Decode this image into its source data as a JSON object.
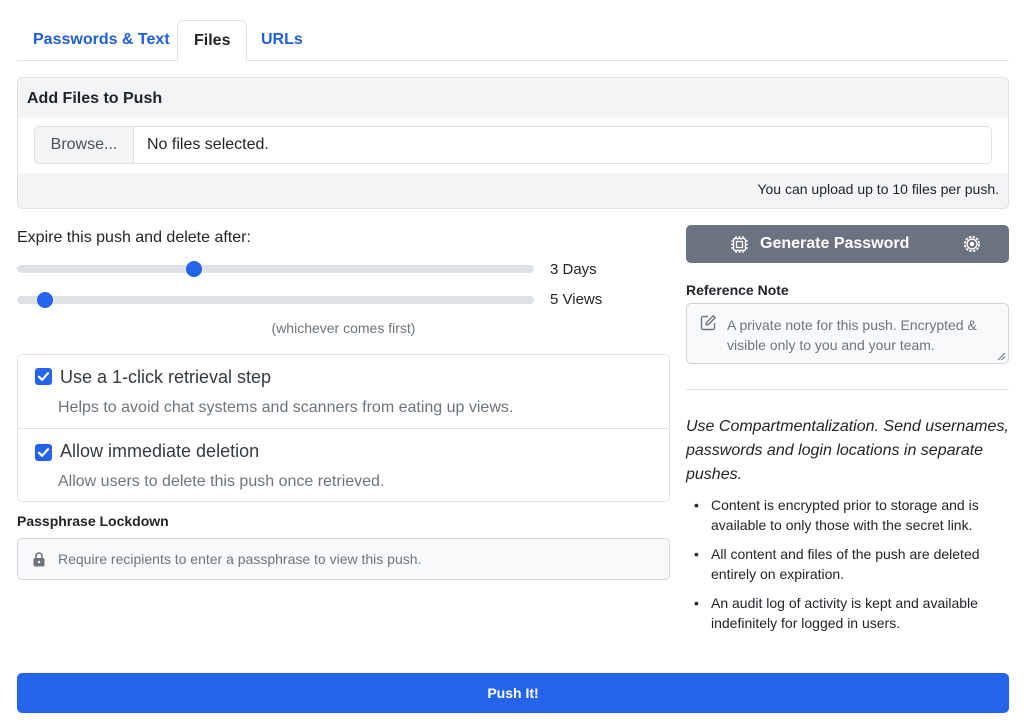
{
  "tabs": [
    {
      "label": "Passwords & Text"
    },
    {
      "label": "Files"
    },
    {
      "label": "URLs"
    }
  ],
  "active_tab": "Files",
  "files_card": {
    "header": "Add Files to Push",
    "browse_label": "Browse...",
    "status": "No files selected.",
    "footer": "You can upload up to 10 files per push."
  },
  "expire": {
    "label": "Expire this push and delete after:",
    "days": {
      "value": 3,
      "display": "3 Days"
    },
    "views": {
      "value": 5,
      "display": "5 Views"
    },
    "note": "(whichever comes first)"
  },
  "options": [
    {
      "title": "Use a 1-click retrieval step",
      "description": "Helps to avoid chat systems and scanners from eating up views.",
      "checked": true
    },
    {
      "title": "Allow immediate deletion",
      "description": "Allow users to delete this push once retrieved.",
      "checked": true
    }
  ],
  "passphrase": {
    "label": "Passphrase Lockdown",
    "placeholder": "Require recipients to enter a passphrase to view this push."
  },
  "generator": {
    "label": "Generate Password"
  },
  "reference_note": {
    "label": "Reference Note",
    "placeholder": "A private note for this push.  Encrypted & visible only to you and your team."
  },
  "tips": {
    "headline": "Use Compartmentalization. Send usernames, passwords and login locations in separate pushes.",
    "items": [
      "Content is encrypted prior to storage and is available to only those with the secret link.",
      "All content and files of the push are deleted entirely on expiration.",
      "An audit log of activity is kept and available indefinitely for logged in users."
    ]
  },
  "submit_label": "Push It!",
  "colors": {
    "primary": "#2563eb",
    "secondary": "#6b7280",
    "link": "#1f5fd6"
  }
}
